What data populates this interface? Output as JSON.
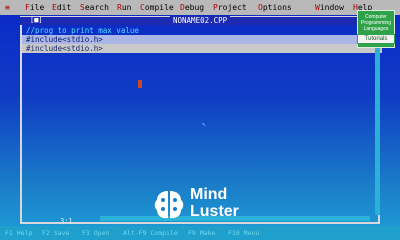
{
  "menu": {
    "system": "≡",
    "items": [
      {
        "hotkey": "F",
        "rest": "ile"
      },
      {
        "hotkey": "E",
        "rest": "dit"
      },
      {
        "hotkey": "S",
        "rest": "earch"
      },
      {
        "hotkey": "R",
        "rest": "un"
      },
      {
        "hotkey": "C",
        "rest": "ompile"
      },
      {
        "hotkey": "D",
        "rest": "ebug"
      },
      {
        "hotkey": "P",
        "rest": "roject"
      },
      {
        "hotkey": "O",
        "rest": "ptions"
      },
      {
        "hotkey": "W",
        "rest": "indow"
      },
      {
        "hotkey": "H",
        "rest": "elp"
      }
    ]
  },
  "editor": {
    "close_glyph": "[■]",
    "title": "NONAME02.CPP",
    "lines": [
      "//prog to print max value",
      "#include<stdio.h>",
      "#include<stdio.h>"
    ],
    "position": "3:1"
  },
  "statusbar": {
    "items": [
      "F1 Help",
      "F2 Save",
      "F3 Open",
      "Alt-F9 Compile",
      "F9 Make",
      "F10 Menu"
    ]
  },
  "badge": {
    "line1": "Computer",
    "line2": "Programming",
    "line3": "Languages",
    "tutorials": "Tutorials"
  },
  "watermark": {
    "word1": "Mind",
    "word2": "Luster"
  }
}
